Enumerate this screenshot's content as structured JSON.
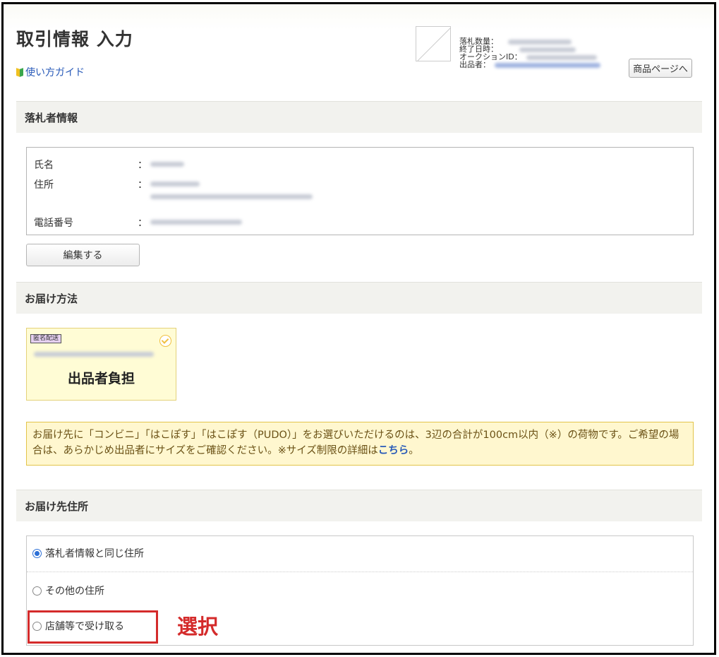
{
  "header": {
    "title": "取引情報 入力",
    "guide_link": "使い方ガイド",
    "meta": {
      "quantity_label": "落札数量：",
      "end_label": "終了日時：",
      "auction_id_label": "オークションID：",
      "seller_label": "出品者："
    },
    "product_page_button": "商品ページへ"
  },
  "winner": {
    "heading": "落札者情報",
    "name_label": "氏名",
    "address_label": "住所",
    "phone_label": "電話番号",
    "colon": "：",
    "edit_button": "編集する"
  },
  "delivery": {
    "heading": "お届け方法",
    "badge": "匿名配送",
    "option_title": "出品者負担",
    "notice_text": "お届け先に「コンビニ」「はこぽす」「はこぽす（PUDO）」をお選びいただけるのは、3辺の合計が100cm以内（※）の荷物です。ご希望の場合は、あらかじめ出品者にサイズをご確認ください。※サイズ制限の詳細は",
    "notice_link": "こちら",
    "notice_end": "。"
  },
  "address": {
    "heading": "お届け先住所",
    "options": [
      {
        "label": "落札者情報と同じ住所",
        "selected": true
      },
      {
        "label": "その他の住所",
        "selected": false
      },
      {
        "label": "店舗等で受け取る",
        "selected": false
      }
    ]
  },
  "annotation": {
    "label": "選択",
    "color": "#d42b2b"
  },
  "colors": {
    "link": "#2759b8",
    "section_bg": "#f2f2ee",
    "card_bg": "#fffcd5",
    "notice_bg": "#fff7cf",
    "radio_selected": "#2b6fd6"
  }
}
